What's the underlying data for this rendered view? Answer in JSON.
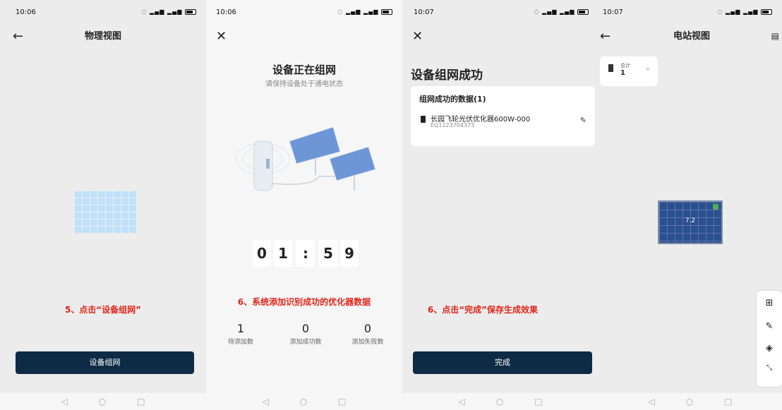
{
  "panels": [
    {
      "status_time": "10:06",
      "title": "物理视图",
      "annotation": "5、点击“设备组网”",
      "button_label": "设备组网"
    },
    {
      "status_time": "10:06",
      "title": "设备正在组网",
      "subtitle": "请保持设备处于通电状态",
      "timer": [
        "0",
        "1",
        ":",
        "5",
        "9"
      ],
      "annotation": "6、系统添加识别成功的优化器数据",
      "stats": [
        {
          "value": "1",
          "label": "待添加数"
        },
        {
          "value": "0",
          "label": "添加成功数"
        },
        {
          "value": "0",
          "label": "添加失败数"
        }
      ]
    },
    {
      "status_time": "10:07",
      "title": "设备组网成功",
      "card_header": "组网成功的数据(1)",
      "device_name": "长园飞轮光伏优化器600W-000",
      "device_sn": "EQ1123704373",
      "annotation": "6、点击“完成”保存生成效果",
      "button_label": "完成"
    },
    {
      "status_time": "10:07",
      "title": "电站视图",
      "total_label": "总计",
      "total_value": "1",
      "panel_value": "7.2"
    }
  ],
  "icons": {
    "back": "arrow-left-icon",
    "close": "close-icon",
    "edit": "pencil-icon",
    "tools": [
      "add-image-icon",
      "pencil-icon",
      "layers-icon",
      "collapse-icon"
    ]
  }
}
